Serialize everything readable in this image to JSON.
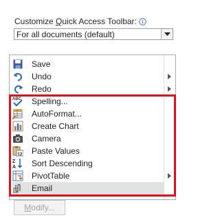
{
  "toolbar_section": {
    "title_before": "Customize ",
    "title_accel": "Q",
    "title_after": "uick Access Toolbar:",
    "scope_dropdown_value": "For all documents (default)"
  },
  "commands": [
    {
      "label": "Save",
      "icon": "save-icon",
      "has_submenu": false
    },
    {
      "label": "Undo",
      "icon": "undo-icon",
      "has_submenu": true
    },
    {
      "label": "Redo",
      "icon": "redo-icon",
      "has_submenu": true
    },
    {
      "label": "Spelling...",
      "icon": "spelling-icon",
      "has_submenu": false
    },
    {
      "label": "AutoFormat...",
      "icon": "autoformat-icon",
      "has_submenu": false
    },
    {
      "label": "Create Chart",
      "icon": "chart-icon",
      "has_submenu": false
    },
    {
      "label": "Camera",
      "icon": "camera-icon",
      "has_submenu": false
    },
    {
      "label": "Paste Values",
      "icon": "paste-values-icon",
      "has_submenu": false
    },
    {
      "label": "Sort Descending",
      "icon": "sort-descending-icon",
      "has_submenu": false
    },
    {
      "label": "PivotTable",
      "icon": "pivottable-icon",
      "has_submenu": true
    },
    {
      "label": "Email",
      "icon": "email-icon",
      "has_submenu": false,
      "selected": true
    }
  ],
  "buttons": {
    "modify_before": "",
    "modify_accel": "M",
    "modify_after": "odify..."
  },
  "colors": {
    "highlight_border": "#e0101e",
    "selected_row": "#e1e1e1",
    "save_blue": "#3a5a9a",
    "arrow_blue": "#2e6cb5"
  }
}
